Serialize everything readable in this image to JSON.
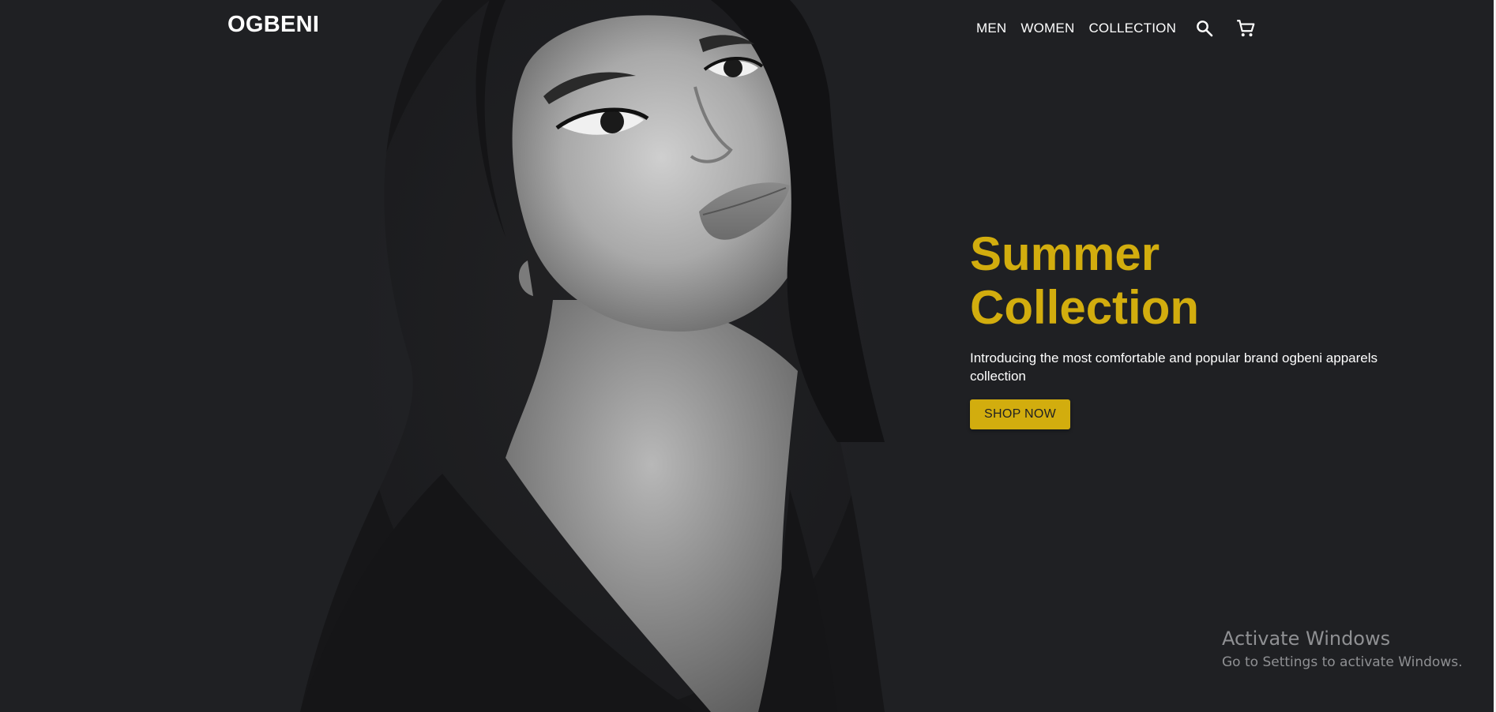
{
  "brand": {
    "logo": "OGBENI"
  },
  "nav": {
    "items": [
      {
        "label": "MEN"
      },
      {
        "label": "WOMEN"
      },
      {
        "label": "COLLECTION"
      }
    ],
    "search_icon": "search-icon",
    "cart_icon": "cart-icon"
  },
  "hero": {
    "title_line1": "Summer",
    "title_line2": "Collection",
    "subtitle": "Introducing the most comfortable and popular brand ogbeni apparels collection",
    "cta_label": "SHOP NOW",
    "image": "black-and-white portrait of a woman"
  },
  "watermark": {
    "title": "Activate Windows",
    "subtitle": "Go to Settings to activate Windows."
  },
  "colors": {
    "background": "#1f2023",
    "accent": "#d2ad0e",
    "text": "#ffffff"
  }
}
